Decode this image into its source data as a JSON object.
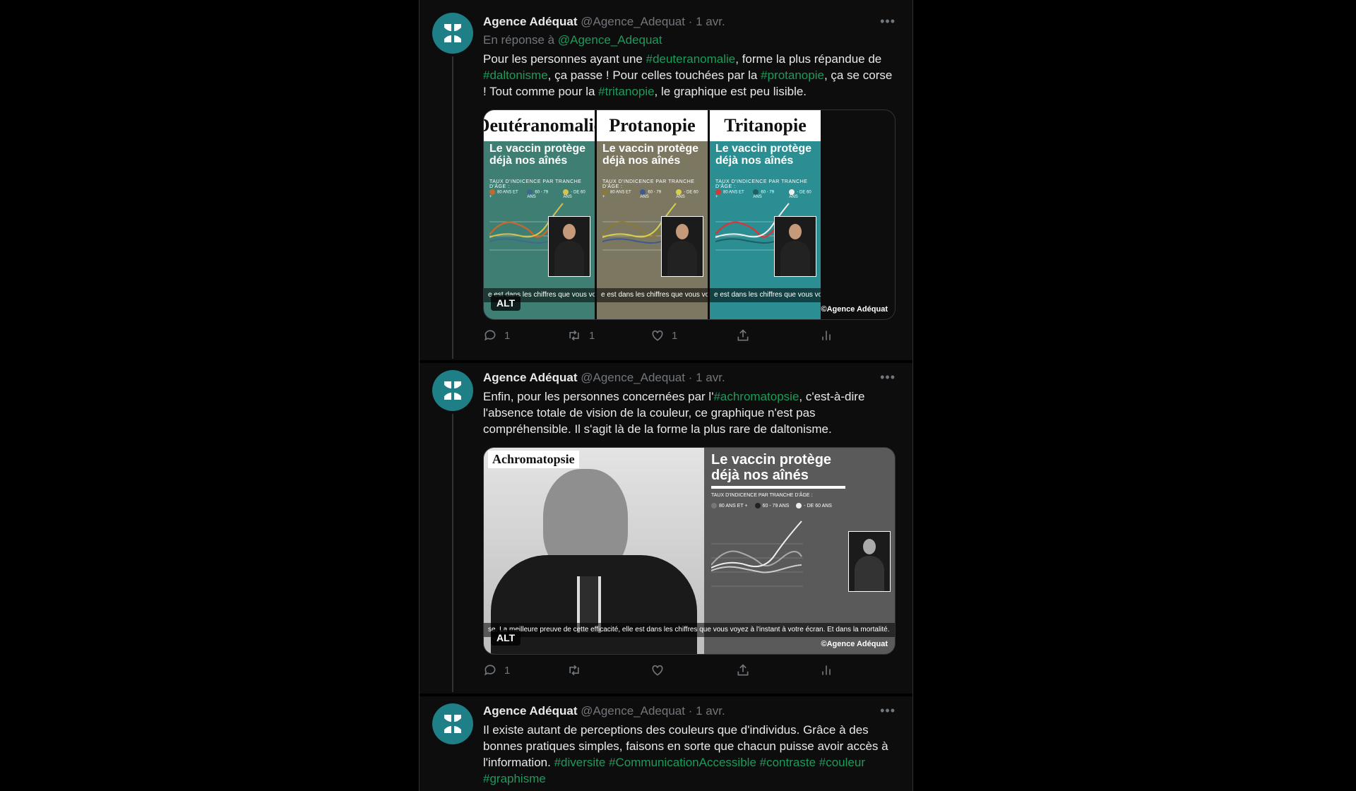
{
  "tweets": [
    {
      "author_name": "Agence Adéquat",
      "handle": "@Agence_Adequat",
      "date": "· 1 avr.",
      "reply_prefix": "En réponse à",
      "reply_handle": "@Agence_Adequat",
      "text_parts": [
        {
          "t": "Pour les personnes ayant une ",
          "tag": false
        },
        {
          "t": "#deuteranomalie",
          "tag": true
        },
        {
          "t": ", forme la plus répandue de ",
          "tag": false
        },
        {
          "t": "#daltonisme",
          "tag": true
        },
        {
          "t": ", ça passe ! Pour celles touchées par la ",
          "tag": false
        },
        {
          "t": "#protanopie",
          "tag": true
        },
        {
          "t": ", ça se corse ! Tout comme pour la ",
          "tag": false
        },
        {
          "t": "#tritanopie",
          "tag": true
        },
        {
          "t": ", le graphique est peu lisible.",
          "tag": false
        }
      ],
      "media": {
        "panels": [
          {
            "title": "Deutéranomalie",
            "bg": "#3e7e73"
          },
          {
            "title": "Protanopie",
            "bg": "#7c7761"
          },
          {
            "title": "Tritanopie",
            "bg": "#2a8e93"
          }
        ],
        "chart_heading_1": "Le vaccin protège",
        "chart_heading_2": "déjà nos aînés",
        "chart_sub": "TAUX D'INDICENCE PAR TRANCHE D'ÂGE :",
        "legend": [
          "80 ANS ET +",
          "60 - 79 ANS",
          "- DE 60 ANS"
        ],
        "strip_text": "e est dans les chiffres que vous voyez à",
        "alt_label": "ALT",
        "credit": "©Agence Adéquat"
      },
      "actions": {
        "reply": "1",
        "retweet": "1",
        "like": "1"
      }
    },
    {
      "author_name": "Agence Adéquat",
      "handle": "@Agence_Adequat",
      "date": "· 1 avr.",
      "text_parts": [
        {
          "t": "Enfin, pour les personnes concernées par l'",
          "tag": false
        },
        {
          "t": "#achromatopsie",
          "tag": true
        },
        {
          "t": ", c'est-à-dire l'absence totale de vision de la couleur, ce graphique n'est pas compréhensible. Il s'agit là de la forme la plus rare de daltonisme.",
          "tag": false
        }
      ],
      "media": {
        "label": "Achromatopsie",
        "chart_heading_1": "Le vaccin protège",
        "chart_heading_2": "déjà nos aînés",
        "chart_sub": "TAUX D'INDICENCE PAR TRANCHE D'ÂGE :",
        "legend": [
          "80 ANS ET +",
          "60 - 79 ANS",
          "- DE 60 ANS"
        ],
        "strip_text": "se. La meilleure preuve de cette efficacité, elle est dans les chiffres que vous voyez à l'instant à votre écran. Et dans la mortalité.",
        "alt_label": "ALT",
        "credit": "©Agence Adéquat"
      },
      "actions": {
        "reply": "1",
        "retweet": "",
        "like": ""
      }
    },
    {
      "author_name": "Agence Adéquat",
      "handle": "@Agence_Adequat",
      "date": "· 1 avr.",
      "text_parts": [
        {
          "t": "Il existe autant de perceptions des couleurs que d'individus. Grâce à des bonnes pratiques simples, faisons en sorte que chacun puisse avoir accès à l'information. ",
          "tag": false
        },
        {
          "t": "#diversite",
          "tag": true
        },
        {
          "t": " ",
          "tag": false
        },
        {
          "t": "#CommunicationAccessible",
          "tag": true
        },
        {
          "t": " ",
          "tag": false
        },
        {
          "t": "#contraste",
          "tag": true
        },
        {
          "t": " ",
          "tag": false
        },
        {
          "t": "#couleur",
          "tag": true
        },
        {
          "t": " ",
          "tag": false
        },
        {
          "t": "#graphisme",
          "tag": true
        }
      ]
    }
  ],
  "colors": {
    "accent": "#1d9b5a",
    "avatar": "#1f7f86",
    "background": "#000000"
  }
}
